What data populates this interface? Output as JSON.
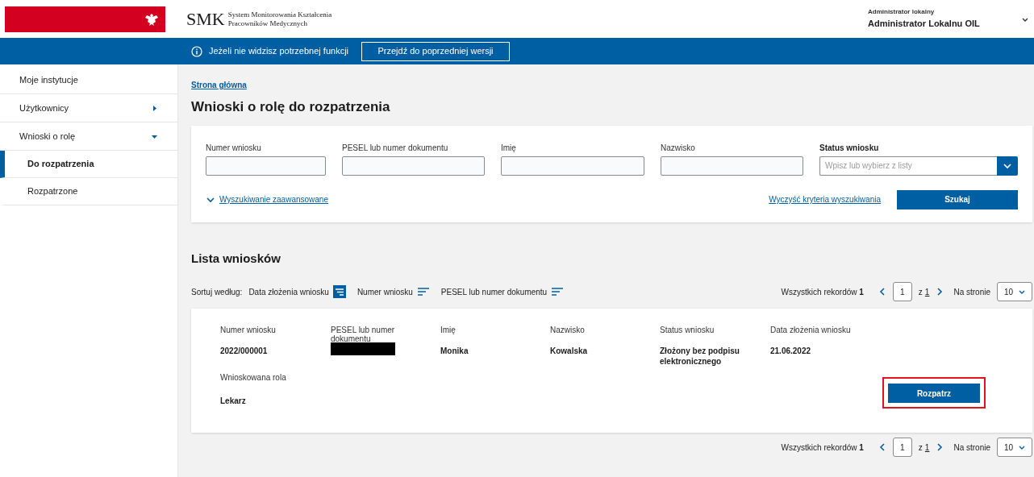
{
  "header": {
    "logo": "SMK",
    "logo_subtitle_1": "System Monitorowania Kształcenia",
    "logo_subtitle_2": "Pracowników Medycznych",
    "user_role": "Administrator lokalny",
    "user_name": "Administrator Lokalnu OIL"
  },
  "notice_bar": {
    "text": "Jeżeli nie widzisz potrzebnej funkcji",
    "button": "Przejdź do poprzedniej wersji"
  },
  "sidebar": {
    "items": [
      {
        "label": "Moje instytucje",
        "selected": false
      },
      {
        "label": "Użytkownicy",
        "selected": false,
        "expanded": false
      },
      {
        "label": "Wnioski o rolę",
        "selected": false,
        "expanded": true,
        "children": [
          {
            "label": "Do rozpatrzenia",
            "selected": true
          },
          {
            "label": "Rozpatrzone",
            "selected": false
          }
        ]
      }
    ]
  },
  "breadcrumb": "Strona główna",
  "title": "Wnioski o rolę do rozpatrzenia",
  "search": {
    "fields": [
      {
        "label": "Numer wniosku",
        "kind": "text"
      },
      {
        "label": "PESEL lub numer dokumentu",
        "kind": "text"
      },
      {
        "label": "Imię",
        "kind": "text"
      },
      {
        "label": "Nazwisko",
        "kind": "text"
      },
      {
        "label": "Status wniosku",
        "kind": "select",
        "placeholder": "Wpisz lub wybierz z listy"
      }
    ],
    "advanced_link": "Wyszukiwanie zaawansowane",
    "clear_link": "Wyczyść kryteria wyszukiwania",
    "search_button": "Szukaj"
  },
  "list": {
    "heading": "Lista wniosków",
    "sort_label": "Sortuj według:",
    "sort_options": [
      {
        "label": "Data złożenia wniosku",
        "selected": true
      },
      {
        "label": "Numer wniosku",
        "selected": false
      },
      {
        "label": "PESEL lub numer dokumentu",
        "selected": false
      }
    ],
    "pagination_top": {
      "total_label": "Wszystkich rekordów",
      "total": "1",
      "page": "1",
      "of": "z",
      "pages": "1",
      "per_page_label": "Na stronie",
      "per_page": "10"
    },
    "pagination_bottom": {
      "total_label": "Wszystkich rekordów",
      "total": "1",
      "page": "1",
      "of": "z",
      "pages": "1",
      "per_page_label": "Na stronie",
      "per_page": "10"
    },
    "records": [
      {
        "columns": [
          {
            "label": "Numer wniosku",
            "value": "2022/000001"
          },
          {
            "label": "PESEL lub numer dokumentu",
            "redacted": true
          },
          {
            "label": "Imię",
            "value": "Monika"
          },
          {
            "label": "Nazwisko",
            "value": "Kowalska"
          },
          {
            "label": "Status wniosku",
            "value": "Złożony bez podpisu elektronicznego"
          },
          {
            "label": "Data złożenia wniosku",
            "value": "21.06.2022"
          }
        ],
        "role_label": "Wnioskowana rola",
        "role": "Lekarz",
        "action": "Rozpatrz",
        "highlighted": true
      }
    ]
  }
}
